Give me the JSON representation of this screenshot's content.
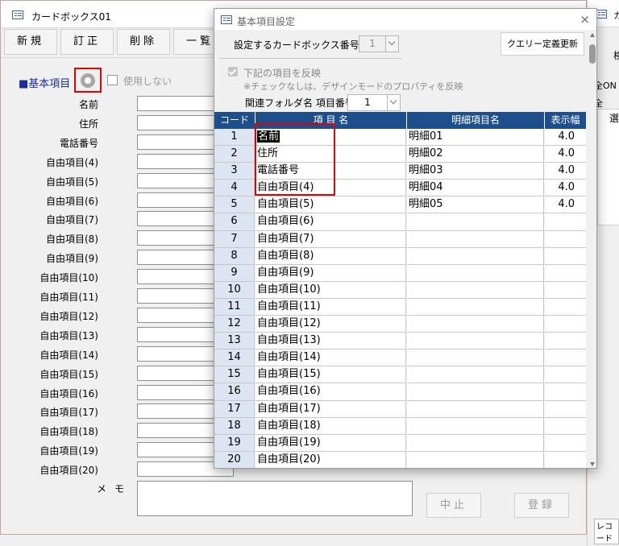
{
  "bg_window": {
    "title": "カードボックス01",
    "toolbar": [
      "新規",
      "訂正",
      "削除",
      "一覧"
    ],
    "section_title": "■基本項目",
    "unused_label": "使用しない",
    "fields": [
      "名前",
      "住所",
      "電話番号",
      "自由項目(4)",
      "自由項目(5)",
      "自由項目(6)",
      "自由項目(7)",
      "自由項目(8)",
      "自由項目(9)",
      "自由項目(10)",
      "自由項目(11)",
      "自由項目(12)",
      "自由項目(13)",
      "自由項目(14)",
      "自由項目(15)",
      "自由項目(16)",
      "自由項目(17)",
      "自由項目(18)",
      "自由項目(19)",
      "自由項目(20)"
    ],
    "memo_label": "メモ",
    "cancel_button": "中止",
    "register_button": "登録"
  },
  "bg_window2": {
    "title_char": "カ",
    "top_char": "検",
    "all_on": "全ON",
    "all_off": "全OFF",
    "select_char": "選",
    "record_text": "レコード"
  },
  "dialog": {
    "title": "基本項目設定",
    "close": "×",
    "cardbox_label": "設定するカードボックス番号",
    "cardbox_value": "1",
    "query_button": "クエリー定義更新",
    "reflect_label": "下記の項目を反映",
    "reflect_checked": true,
    "reflect_note": "※チェックなしは、デザインモードのプロパティを反映",
    "folder_label": "関連フォルダ名 項目番号",
    "folder_value": "1",
    "table": {
      "headers": [
        "コード",
        "項 目 名",
        "明細項目名",
        "表示幅"
      ],
      "rows": [
        {
          "code": "1",
          "name": "名前",
          "detail": "明細01",
          "width": "4.0"
        },
        {
          "code": "2",
          "name": "住所",
          "detail": "明細02",
          "width": "4.0"
        },
        {
          "code": "3",
          "name": "電話番号",
          "detail": "明細03",
          "width": "4.0"
        },
        {
          "code": "4",
          "name": "自由項目(4)",
          "detail": "明細04",
          "width": "4.0"
        },
        {
          "code": "5",
          "name": "自由項目(5)",
          "detail": "明細05",
          "width": "4.0"
        },
        {
          "code": "6",
          "name": "自由項目(6)",
          "detail": "",
          "width": ""
        },
        {
          "code": "7",
          "name": "自由項目(7)",
          "detail": "",
          "width": ""
        },
        {
          "code": "8",
          "name": "自由項目(8)",
          "detail": "",
          "width": ""
        },
        {
          "code": "9",
          "name": "自由項目(9)",
          "detail": "",
          "width": ""
        },
        {
          "code": "10",
          "name": "自由項目(10)",
          "detail": "",
          "width": ""
        },
        {
          "code": "11",
          "name": "自由項目(11)",
          "detail": "",
          "width": ""
        },
        {
          "code": "12",
          "name": "自由項目(12)",
          "detail": "",
          "width": ""
        },
        {
          "code": "13",
          "name": "自由項目(13)",
          "detail": "",
          "width": ""
        },
        {
          "code": "14",
          "name": "自由項目(14)",
          "detail": "",
          "width": ""
        },
        {
          "code": "15",
          "name": "自由項目(15)",
          "detail": "",
          "width": ""
        },
        {
          "code": "16",
          "name": "自由項目(16)",
          "detail": "",
          "width": ""
        },
        {
          "code": "17",
          "name": "自由項目(17)",
          "detail": "",
          "width": ""
        },
        {
          "code": "18",
          "name": "自由項目(18)",
          "detail": "",
          "width": ""
        },
        {
          "code": "19",
          "name": "自由項目(19)",
          "detail": "",
          "width": ""
        },
        {
          "code": "20",
          "name": "自由項目(20)",
          "detail": "",
          "width": ""
        }
      ]
    }
  },
  "colors": {
    "header_blue": "#1f4e8c",
    "code_cell": "#dde4f2",
    "highlight_red": "#e00000",
    "section_blue": "#1c2d9b"
  }
}
